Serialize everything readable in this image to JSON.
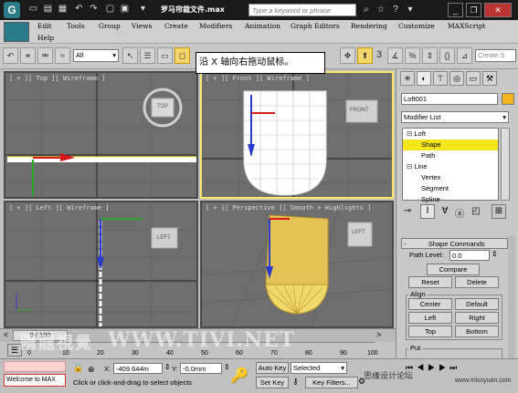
{
  "app": {
    "title": "罗马帘裁文件.max",
    "search_placeholder": "Type a keyword or phrase",
    "logo_letter": "G"
  },
  "menu": {
    "items": [
      "Edit",
      "Tools",
      "Group",
      "Views",
      "Create",
      "Modifiers",
      "Animation",
      "Graph Editors",
      "Rendering",
      "Customize",
      "MAXScript"
    ],
    "help": "Help"
  },
  "toolbar": {
    "selection_filter": "All",
    "create_selection_set": "Create S",
    "snaps_label": "3"
  },
  "tooltip": "沿 X 轴向右拖动鼠标。",
  "viewports": {
    "top": {
      "label": "[ + ][ Top ][ Wireframe ]",
      "cube_label": "TOP"
    },
    "front": {
      "label": "[ + ][ Front ][ Wireframe ]",
      "cube_label": "FRONT"
    },
    "left": {
      "label": "[ + ][ Left ][ Wireframe ]",
      "cube_label": "LEFT"
    },
    "perspective": {
      "label": "[ + ][ Perspective ][ Smooth + Highlights ]",
      "cube_label": "LEFT"
    }
  },
  "command_panel": {
    "object_name": "Loft001",
    "object_color": "#f2b41c",
    "modifier_list": "Modifier List",
    "stack": [
      "Loft",
      "Shape",
      "Path",
      "Line",
      "Vertex",
      "Segment",
      "Spline"
    ],
    "selected_stack_item": "Shape",
    "rollout_title": "Shape Commands",
    "path_level_label": "Path Level:",
    "path_level_value": "0.0",
    "compare_button": "Compare",
    "reset_button": "Reset",
    "delete_button": "Delete",
    "align_group": "Align",
    "center_button": "Center",
    "default_button": "Default",
    "left_button": "Left",
    "right_button": "Right",
    "top_button": "Top",
    "bottom_button": "Bottom",
    "put_group": "Put"
  },
  "timeline": {
    "frame_display": "0 / 100",
    "ticks": [
      "0",
      "10",
      "20",
      "30",
      "40",
      "50",
      "60",
      "70",
      "80",
      "90",
      "100"
    ]
  },
  "status": {
    "welcome_text": "Welcome to MAX",
    "x_label": "X:",
    "x_value": "-409.644m",
    "y_label": "Y:",
    "y_value": "-0.0mm",
    "prompt": "Click or click-and-drag to select objects",
    "auto_key": "Auto Key",
    "set_key": "Set Key",
    "key_filter_select": "Selected",
    "key_filters": "Key Filters..."
  },
  "watermark": {
    "main": "WWW.TIVI.NET",
    "chinese_left": "隋龍視覺",
    "bottom_right": "思缘设计论坛",
    "url": "www.missyuan.com"
  },
  "colors": {
    "axis_x": "#d81818",
    "axis_y": "#2a3acc",
    "axis_z": "#2aa82a",
    "active_border": "#ffe56a",
    "selection": "#f5e51c"
  }
}
